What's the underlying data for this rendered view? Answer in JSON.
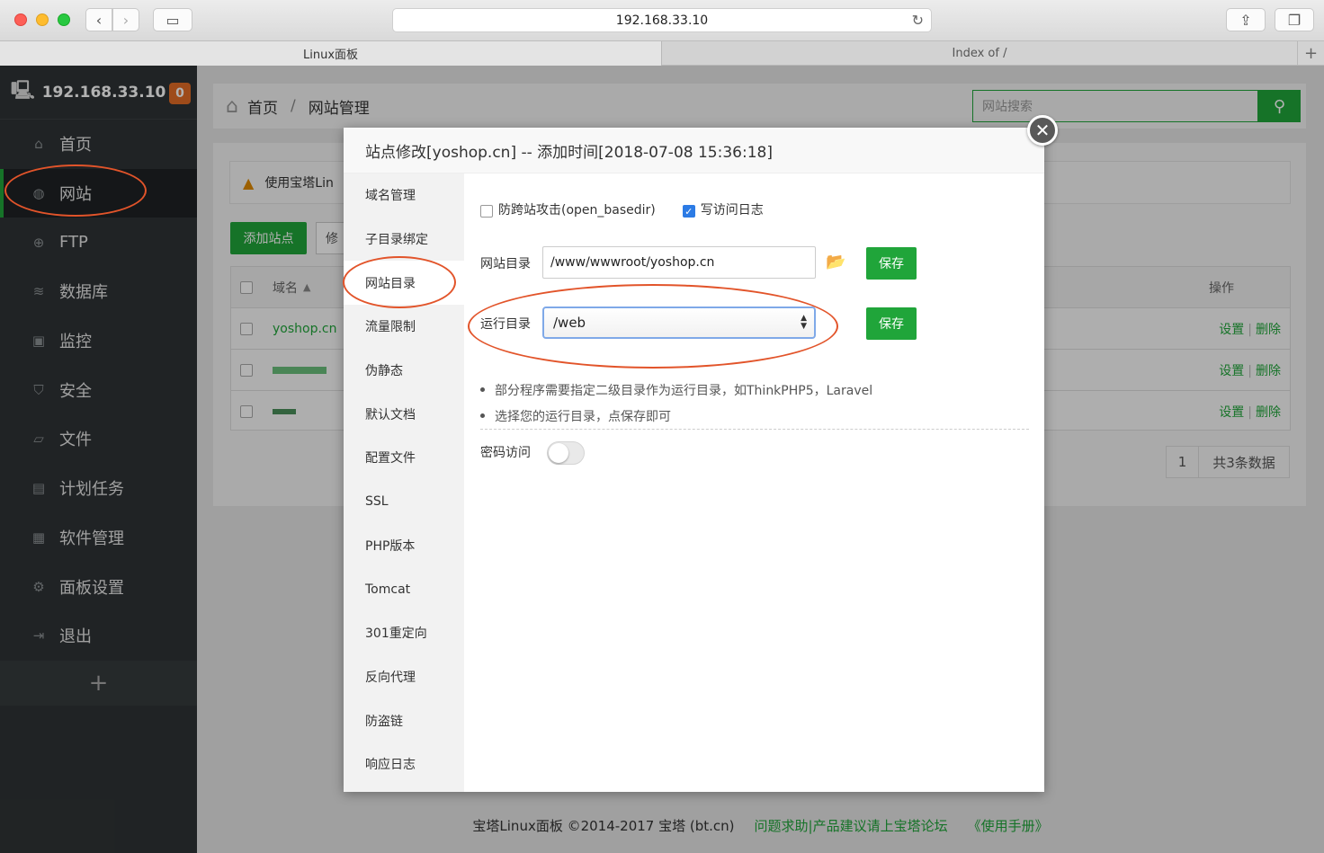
{
  "browser": {
    "address": "192.168.33.10",
    "tabs": [
      {
        "label": "Linux面板"
      },
      {
        "label": "Index of /"
      }
    ]
  },
  "sidebar": {
    "host": "192.168.33.10",
    "badge": "0",
    "items": [
      {
        "label": "首页",
        "icon": "home-icon"
      },
      {
        "label": "网站",
        "icon": "globe-icon"
      },
      {
        "label": "FTP",
        "icon": "ftp-icon"
      },
      {
        "label": "数据库",
        "icon": "database-icon"
      },
      {
        "label": "监控",
        "icon": "monitor-icon"
      },
      {
        "label": "安全",
        "icon": "shield-icon"
      },
      {
        "label": "文件",
        "icon": "folder-icon"
      },
      {
        "label": "计划任务",
        "icon": "calendar-icon"
      },
      {
        "label": "软件管理",
        "icon": "grid-icon"
      },
      {
        "label": "面板设置",
        "icon": "gear-icon"
      },
      {
        "label": "退出",
        "icon": "logout-icon"
      }
    ],
    "add_label": "+"
  },
  "breadcrumb": {
    "home": "首页",
    "separator": "/",
    "current": "网站管理"
  },
  "search": {
    "placeholder": "网站搜索"
  },
  "content": {
    "alert": "使用宝塔Lin",
    "add_site_label": "添加站点",
    "edit_label": "修",
    "table": {
      "header_domain": "域名",
      "header_ops": "操作",
      "rows": [
        {
          "domain": "yoshop.cn"
        },
        {
          "domain": ""
        },
        {
          "domain": ""
        }
      ],
      "op_set": "设置",
      "op_sep": "|",
      "op_delete": "删除"
    },
    "pager": {
      "page": "1",
      "total": "共3条数据"
    }
  },
  "footer": {
    "copyright": "宝塔Linux面板 ©2014-2017 宝塔 (bt.cn)",
    "forum_link": "问题求助|产品建议请上宝塔论坛",
    "manual_link": "《使用手册》"
  },
  "modal": {
    "title": "站点修改[yoshop.cn] -- 添加时间[2018-07-08 15:36:18]",
    "nav": [
      {
        "label": "域名管理"
      },
      {
        "label": "子目录绑定"
      },
      {
        "label": "网站目录"
      },
      {
        "label": "流量限制"
      },
      {
        "label": "伪静态"
      },
      {
        "label": "默认文档"
      },
      {
        "label": "配置文件"
      },
      {
        "label": "SSL"
      },
      {
        "label": "PHP版本"
      },
      {
        "label": "Tomcat"
      },
      {
        "label": "301重定向"
      },
      {
        "label": "反向代理"
      },
      {
        "label": "防盗链"
      },
      {
        "label": "响应日志"
      }
    ],
    "anti_xss_label": "防跨站攻击(open_basedir)",
    "anti_xss_checked": false,
    "access_log_label": "写访问日志",
    "access_log_checked": true,
    "site_dir_label": "网站目录",
    "site_dir_value": "/www/wwwroot/yoshop.cn",
    "run_dir_label": "运行目录",
    "run_dir_value": "/web",
    "save_label": "保存",
    "tips": [
      "部分程序需要指定二级目录作为运行目录，如ThinkPHP5，Laravel",
      "选择您的运行目录，点保存即可"
    ],
    "password_label": "密码访问",
    "password_enabled": false
  },
  "colors": {
    "accent": "#20a53a",
    "sidebar_bg": "#2f3335",
    "badge": "#e36c26",
    "annotation": "#e2542a"
  }
}
